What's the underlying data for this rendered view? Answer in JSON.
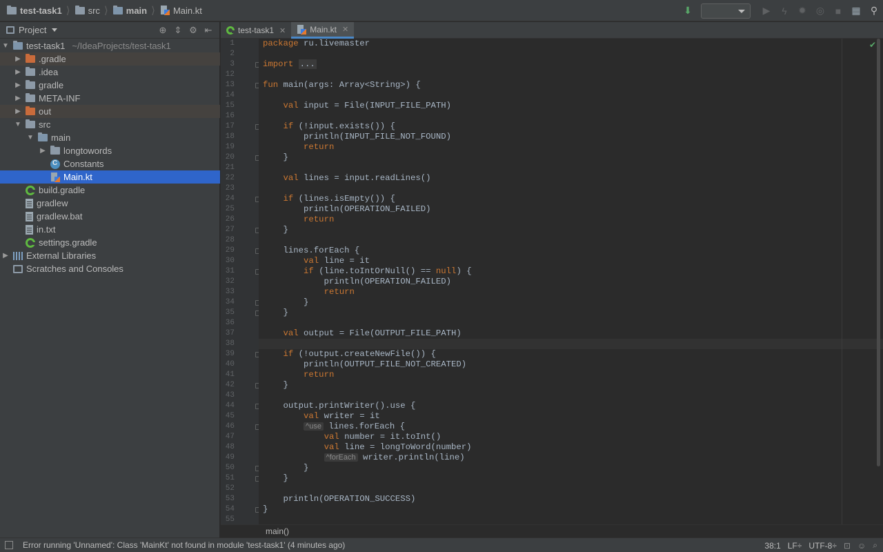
{
  "breadcrumbs": [
    {
      "label": "test-task1",
      "bold": true
    },
    {
      "label": "src",
      "bold": false
    },
    {
      "label": "main",
      "bold": true
    },
    {
      "label": "Main.kt",
      "bold": false
    }
  ],
  "project_panel": {
    "title": "Project",
    "tree": [
      {
        "label": "test-task1",
        "path": "~/IdeaProjects/test-task1",
        "depth": 0,
        "arrow": "down",
        "icon": "module-folder-icon"
      },
      {
        "label": ".gradle",
        "depth": 1,
        "arrow": "right",
        "icon": "excluded-folder-icon",
        "highlight": true
      },
      {
        "label": ".idea",
        "depth": 1,
        "arrow": "right",
        "icon": "folder-icon"
      },
      {
        "label": "gradle",
        "depth": 1,
        "arrow": "right",
        "icon": "folder-icon"
      },
      {
        "label": "META-INF",
        "depth": 1,
        "arrow": "right",
        "icon": "folder-icon"
      },
      {
        "label": "out",
        "depth": 1,
        "arrow": "right",
        "icon": "excluded-folder-icon",
        "highlight": true
      },
      {
        "label": "src",
        "depth": 1,
        "arrow": "down",
        "icon": "folder-icon"
      },
      {
        "label": "main",
        "depth": 2,
        "arrow": "down",
        "icon": "source-folder-icon"
      },
      {
        "label": "longtowords",
        "depth": 3,
        "arrow": "right",
        "icon": "package-icon"
      },
      {
        "label": "Constants",
        "depth": 3,
        "arrow": "",
        "icon": "kotlin-class-icon"
      },
      {
        "label": "Main.kt",
        "depth": 3,
        "arrow": "",
        "icon": "kotlin-file-icon",
        "selected": true
      },
      {
        "label": "build.gradle",
        "depth": 1,
        "arrow": "",
        "icon": "gradle-icon"
      },
      {
        "label": "gradlew",
        "depth": 1,
        "arrow": "",
        "icon": "text-file-icon"
      },
      {
        "label": "gradlew.bat",
        "depth": 1,
        "arrow": "",
        "icon": "text-file-icon"
      },
      {
        "label": "in.txt",
        "depth": 1,
        "arrow": "",
        "icon": "text-file-icon"
      },
      {
        "label": "settings.gradle",
        "depth": 1,
        "arrow": "",
        "icon": "gradle-icon"
      },
      {
        "label": "External Libraries",
        "depth": 0,
        "arrow": "right",
        "icon": "library-icon"
      },
      {
        "label": "Scratches and Consoles",
        "depth": 0,
        "arrow": "",
        "icon": "scratches-icon"
      }
    ]
  },
  "tabs": [
    {
      "label": "test-task1",
      "active": false,
      "icon": "gradle-icon"
    },
    {
      "label": "Main.kt",
      "active": true,
      "icon": "kotlin-file-icon"
    }
  ],
  "editor": {
    "current_line": 38,
    "lines": [
      {
        "n": "1",
        "html": "<span class=\"kw\">package</span> ru.livemaster"
      },
      {
        "n": "2",
        "html": ""
      },
      {
        "n": "3",
        "html": "<span class=\"kw\">import</span> <span class=\"fold-box\">...</span>",
        "fold": true
      },
      {
        "n": "12",
        "html": ""
      },
      {
        "n": "13",
        "html": "<span class=\"kw\">fun</span> main(args: Array&lt;String&gt;) {",
        "fold": true
      },
      {
        "n": "14",
        "html": ""
      },
      {
        "n": "15",
        "html": "    <span class=\"kw\">val</span> input = File(INPUT_FILE_PATH)"
      },
      {
        "n": "16",
        "html": ""
      },
      {
        "n": "17",
        "html": "    <span class=\"kw\">if</span> (!input.exists()) {",
        "fold": true
      },
      {
        "n": "18",
        "html": "        println(INPUT_FILE_NOT_FOUND)"
      },
      {
        "n": "19",
        "html": "        <span class=\"kw\">return</span>"
      },
      {
        "n": "20",
        "html": "    }",
        "fold": true
      },
      {
        "n": "21",
        "html": ""
      },
      {
        "n": "22",
        "html": "    <span class=\"kw\">val</span> lines = input.readLines()"
      },
      {
        "n": "23",
        "html": ""
      },
      {
        "n": "24",
        "html": "    <span class=\"kw\">if</span> (lines.isEmpty()) {",
        "fold": true
      },
      {
        "n": "25",
        "html": "        println(OPERATION_FAILED)"
      },
      {
        "n": "26",
        "html": "        <span class=\"kw\">return</span>"
      },
      {
        "n": "27",
        "html": "    }",
        "fold": true
      },
      {
        "n": "28",
        "html": ""
      },
      {
        "n": "29",
        "html": "    lines.forEach {",
        "fold": true
      },
      {
        "n": "30",
        "html": "        <span class=\"kw\">val</span> line = it"
      },
      {
        "n": "31",
        "html": "        <span class=\"kw\">if</span> (line.toIntOrNull() == <span class=\"kw\">null</span>) {",
        "fold": true
      },
      {
        "n": "32",
        "html": "            println(OPERATION_FAILED)"
      },
      {
        "n": "33",
        "html": "            <span class=\"kw\">return</span>"
      },
      {
        "n": "34",
        "html": "        }",
        "fold": true
      },
      {
        "n": "35",
        "html": "    }",
        "fold": true
      },
      {
        "n": "36",
        "html": ""
      },
      {
        "n": "37",
        "html": "    <span class=\"kw\">val</span> output = File(OUTPUT_FILE_PATH)"
      },
      {
        "n": "38",
        "html": ""
      },
      {
        "n": "39",
        "html": "    <span class=\"kw\">if</span> (!output.createNewFile()) {",
        "fold": true
      },
      {
        "n": "40",
        "html": "        println(OUTPUT_FILE_NOT_CREATED)"
      },
      {
        "n": "41",
        "html": "        <span class=\"kw\">return</span>"
      },
      {
        "n": "42",
        "html": "    }",
        "fold": true
      },
      {
        "n": "43",
        "html": ""
      },
      {
        "n": "44",
        "html": "    output.printWriter().use {",
        "fold": true
      },
      {
        "n": "45",
        "html": "        <span class=\"kw\">val</span> writer = it"
      },
      {
        "n": "46",
        "html": "        <span class=\"hint\">^use</span> lines.forEach {",
        "fold": true
      },
      {
        "n": "47",
        "html": "            <span class=\"kw\">val</span> number = it.toInt()"
      },
      {
        "n": "48",
        "html": "            <span class=\"kw\">val</span> line = longToWord(number)"
      },
      {
        "n": "49",
        "html": "            <span class=\"hint\">^forEach</span> writer.println(line)"
      },
      {
        "n": "50",
        "html": "        }",
        "fold": true
      },
      {
        "n": "51",
        "html": "    }",
        "fold": true
      },
      {
        "n": "52",
        "html": ""
      },
      {
        "n": "53",
        "html": "    println(OPERATION_SUCCESS)"
      },
      {
        "n": "54",
        "html": "}",
        "fold": true
      },
      {
        "n": "55",
        "html": ""
      }
    ],
    "breadcrumb": "main()"
  },
  "status_bar": {
    "message": "Error running 'Unnamed': Class 'MainKt' not found in module 'test-task1' (4 minutes ago)",
    "position": "38:1",
    "line_separator": "LF÷",
    "encoding": "UTF-8÷"
  },
  "colors": {
    "keyword": "#cc7832",
    "text": "#a9b7c6",
    "selection": "#2f65ca",
    "panel_bg": "#3c3f41",
    "editor_bg": "#2b2b2b"
  }
}
